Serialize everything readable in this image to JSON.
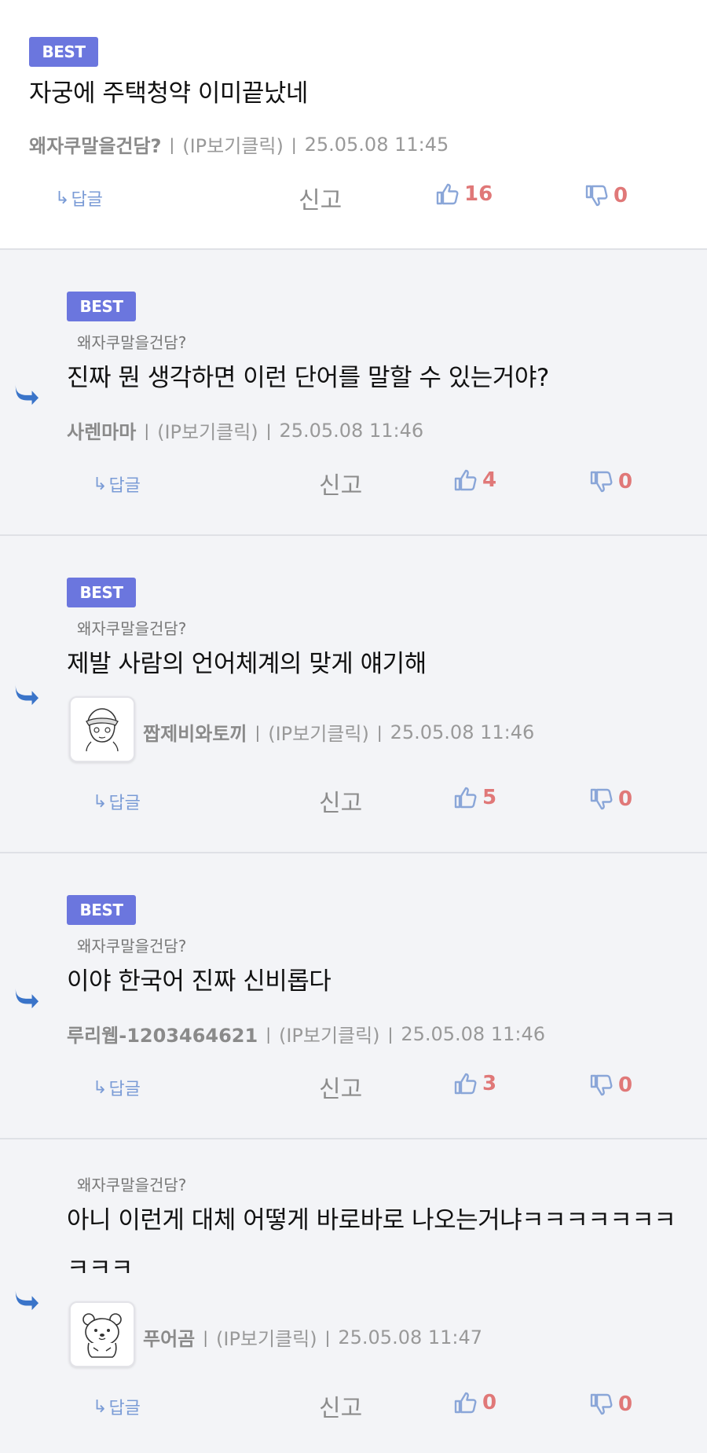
{
  "ui": {
    "best_label": "BEST",
    "reply_label": "답글",
    "report_label": "신고",
    "sep": "|",
    "colors": {
      "best_bg": "#6b76de",
      "count": "#e07878",
      "thumb": "#8aa6d8",
      "reply_arrow": "#3a74c9"
    }
  },
  "comments": [
    {
      "best": true,
      "reply_to": "",
      "text": "자궁에 주택청약 이미끝났네",
      "author": "왜자쿠말을건담?",
      "ip": "(IP보기클릭)",
      "time": "25.05.08 11:45",
      "likes": "16",
      "dislikes": "0"
    },
    {
      "best": true,
      "reply_to": "왜자쿠말을건담?",
      "text": "진짜 뭔 생각하면 이런 단어를 말할 수 있는거야?",
      "author": "사렌마마",
      "ip": "(IP보기클릭)",
      "time": "25.05.08 11:46",
      "likes": "4",
      "dislikes": "0"
    },
    {
      "best": true,
      "reply_to": "왜자쿠말을건담?",
      "text": "제발 사람의 언어체계의 맞게 얘기해",
      "author": "짭제비와토끼",
      "ip": "(IP보기클릭)",
      "time": "25.05.08 11:46",
      "likes": "5",
      "dislikes": "0"
    },
    {
      "best": true,
      "reply_to": "왜자쿠말을건담?",
      "text": "이야 한국어 진짜 신비롭다",
      "author": "루리웹-1203464621",
      "ip": "(IP보기클릭)",
      "time": "25.05.08 11:46",
      "likes": "3",
      "dislikes": "0"
    },
    {
      "best": false,
      "reply_to": "왜자쿠말을건담?",
      "text_line1": "아니 이런게 대체 어떻게 바로바로 나오는거냐ㅋㅋㅋㅋㅋㅋㅋ",
      "text_line2": "ㅋㅋㅋ",
      "author": "푸어곰",
      "ip": "(IP보기클릭)",
      "time": "25.05.08 11:47",
      "likes": "0",
      "dislikes": "0"
    }
  ]
}
